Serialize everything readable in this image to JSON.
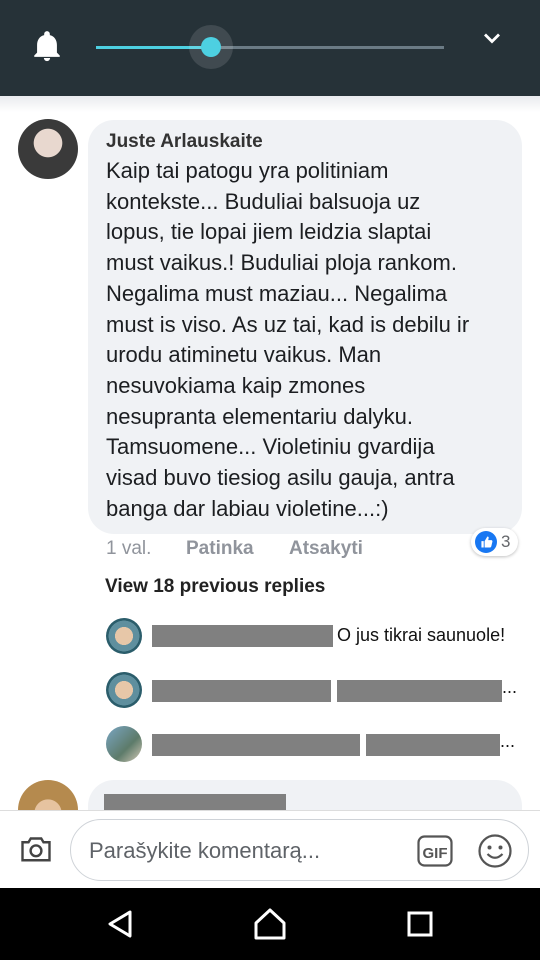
{
  "volume_overlay": {
    "level_fraction": 0.33,
    "accent": "#4dd0e1"
  },
  "comment": {
    "author": "Juste Arlauskaite",
    "lines": [
      "Kaip tai patogu yra politiniam",
      "kontekste... Buduliai balsuoja uz",
      "lopus, tie lopai jiem leidzia slaptai",
      "must vaikus.! Buduliai ploja rankom.",
      "Negalima must maziau... Negalima",
      "must is viso. As uz tai, kad is debilu ir",
      "urodu atiminetu vaikus. Man",
      "nesuvokiama kaip zmones",
      "nesupranta elementariu dalyku.",
      "Tamsuomene... Violetiniu gvardija",
      "visad buvo tiesiog asilu gauja, antra",
      "banga dar labiau violetine...:)"
    ],
    "time": "1 val.",
    "like_label": "Patinka",
    "reply_label": "Atsakyti",
    "reaction_count": "3"
  },
  "view_previous": "View 18 previous replies",
  "replies": [
    {
      "text": "O jus tikrai saunuole!"
    },
    {
      "text": "..."
    },
    {
      "text": "..."
    }
  ],
  "composer": {
    "placeholder": "Parašykite komentarą..."
  },
  "colors": {
    "topbar": "#263238",
    "like_blue": "#1877f2",
    "bubble": "#f0f2f5"
  }
}
